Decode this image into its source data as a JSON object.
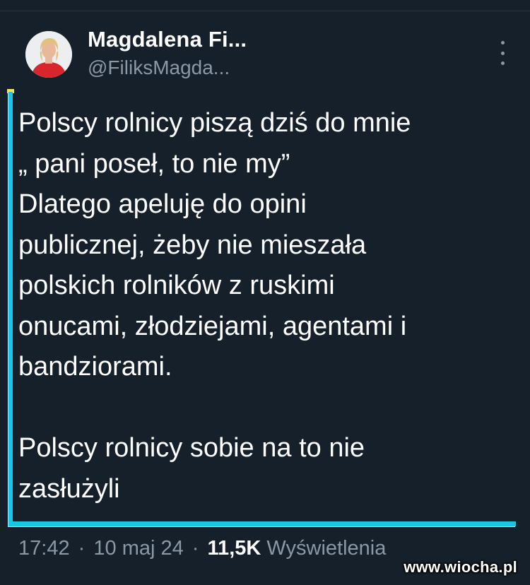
{
  "tweet": {
    "author_name": "Magdalena Fi...",
    "author_handle": "@FiliksMagda...",
    "lines": [
      "Polscy rolnicy piszą dziś do mnie",
      "„ pani poseł, to nie my”",
      "Dlatego apeluję do opini",
      "publicznej, żeby nie mieszała",
      "polskich rolników z ruskimi",
      "onucami, złodziejami, agentami i",
      "bandziorami.",
      "",
      "Polscy rolnicy sobie na to nie",
      "zasłużyli"
    ],
    "time": "17:42",
    "date": "10 maj 24",
    "views_count": "11,5K",
    "views_label": "Wyświetlenia"
  },
  "watermark": "www.wiocha.pl",
  "colors": {
    "background": "#15202b",
    "text_primary": "#ffffff",
    "text_secondary": "#8b98a5",
    "frame_accent": "#19c6e8"
  },
  "icons": {
    "more": "more-vertical-icon"
  }
}
